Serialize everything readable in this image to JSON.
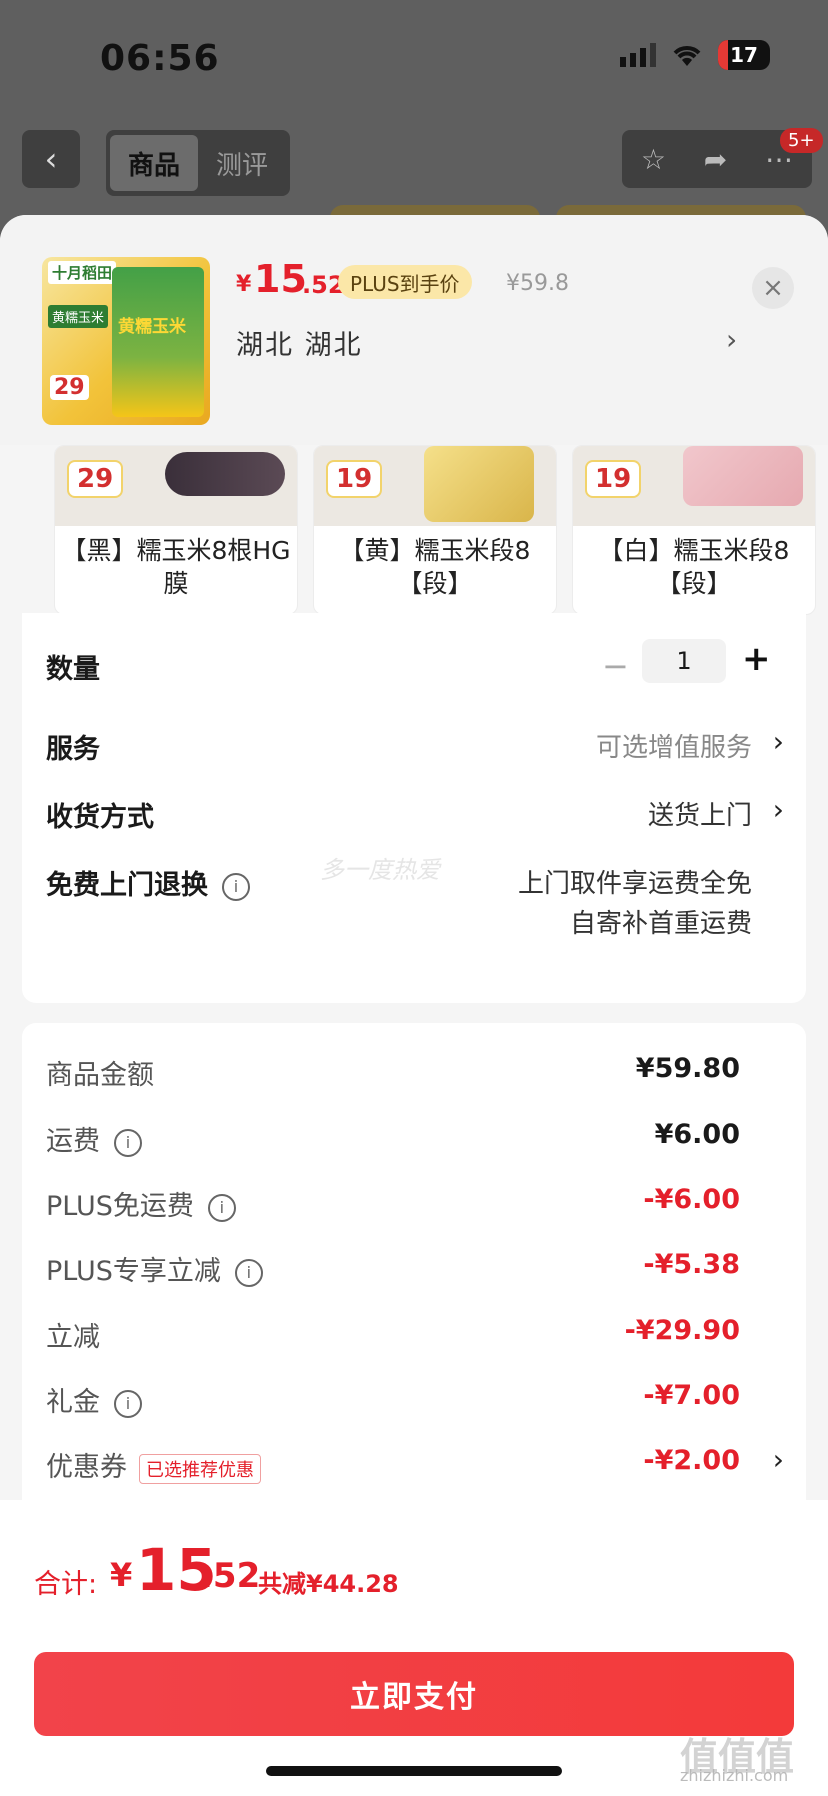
{
  "status_bar": {
    "time": "06:56",
    "battery": "17"
  },
  "nav": {
    "back_icon": "‹",
    "tabs": [
      "商品",
      "测评"
    ],
    "badge": "5+"
  },
  "product": {
    "currency": "¥",
    "price_int": "15",
    "price_dec": ".52",
    "plus_tag": "PLUS到手价",
    "original_price": "¥59.8",
    "address": "湖北  湖北",
    "image": {
      "brand": "十月稻田",
      "tag": "黄糯玉米",
      "bag_text": "黄糯玉米",
      "price": "29"
    }
  },
  "variants": [
    {
      "price": "29",
      "label": "【黑】糯玉米8根HG膜"
    },
    {
      "price": "19",
      "label": "【黄】糯玉米段8【段】"
    },
    {
      "price": "19",
      "label": "【白】糯玉米段8【段】"
    }
  ],
  "options": {
    "quantity_label": "数量",
    "quantity_value": "1",
    "quantity_minus": "−",
    "quantity_plus": "+",
    "service_label": "服务",
    "service_value": "可选增值服务",
    "delivery_label": "收货方式",
    "delivery_value": "送货上门",
    "return_label": "免费上门退换",
    "return_value_line1": "上门取件享运费全免",
    "return_value_line2": "自寄补首重运费",
    "watermark": "多一度热爱"
  },
  "price_rows": [
    {
      "label": "商品金额",
      "value": "¥59.80",
      "info": false,
      "red": false
    },
    {
      "label": "运费",
      "value": "¥6.00",
      "info": true,
      "red": false
    },
    {
      "label": "PLUS免运费",
      "value": "-¥6.00",
      "info": true,
      "red": true
    },
    {
      "label": "PLUS专享立减",
      "value": "-¥5.38",
      "info": true,
      "red": true
    },
    {
      "label": "立减",
      "value": "-¥29.90",
      "info": false,
      "red": true
    },
    {
      "label": "礼金",
      "value": "-¥7.00",
      "info": true,
      "red": true
    },
    {
      "label": "优惠券",
      "value": "-¥2.00",
      "info": false,
      "red": true,
      "tag": "已选推荐优惠"
    }
  ],
  "total": {
    "label": "合计:",
    "currency": "¥",
    "int": "15",
    "dec": ".52",
    "saved": "共减¥44.28"
  },
  "pay_button": "立即支付",
  "site_watermark": {
    "main": "值值值",
    "sub": "zhizhizhi.com"
  },
  "colors": {
    "accent_red": "#e4202b",
    "plus_gold": "#fbe7a8"
  }
}
